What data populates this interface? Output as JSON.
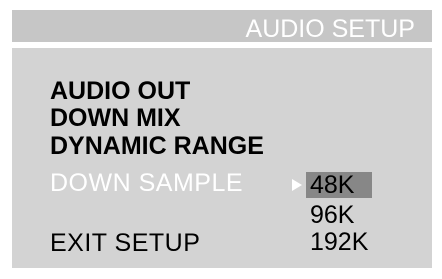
{
  "title": "AUDIO SETUP",
  "menu": {
    "items": [
      {
        "label": "AUDIO OUT"
      },
      {
        "label": "DOWN MIX"
      },
      {
        "label": "DYNAMIC RANGE"
      },
      {
        "label": "DOWN SAMPLE"
      },
      {
        "label": "EXIT  SETUP"
      }
    ],
    "active_index": 3
  },
  "options": {
    "items": [
      "48K",
      "96K",
      "192K"
    ],
    "selected": "48K"
  },
  "colors": {
    "panel": "#d3d3d3",
    "title_bar": "#c6c6c6",
    "title_text": "#ffffff",
    "highlight": "#878787",
    "active_text": "#ffffff"
  },
  "icons": {
    "pointer": "triangle-right-icon"
  }
}
